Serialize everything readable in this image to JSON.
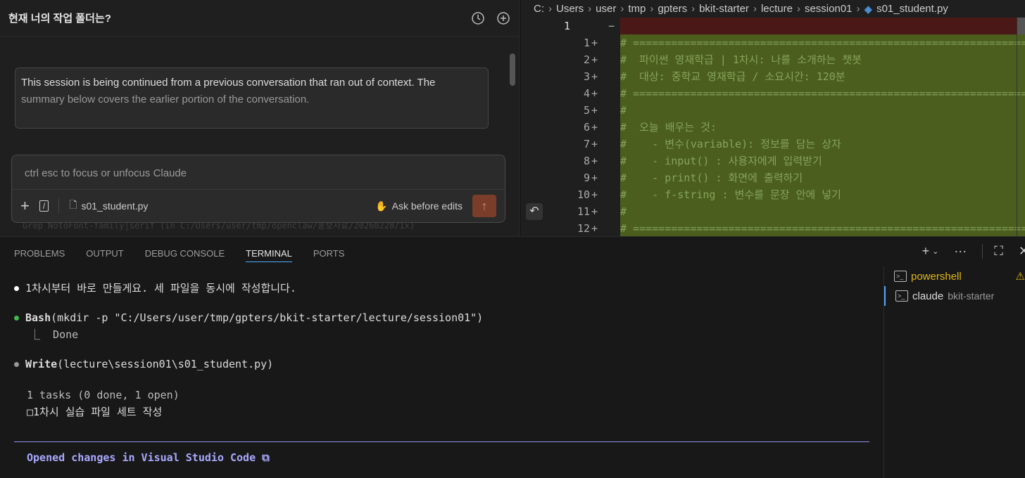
{
  "chat": {
    "title": "현재 너의 작업 폴더는?",
    "message_line1": "This session is being continued from a previous conversation that ran out of context. The",
    "message_line2": "summary below covers the earlier portion of the conversation.",
    "background_tool": "Grep  NotoFont-family|serif  (in C:/Users/user/tmp/openclaw/홍보자료/20260228/1x)",
    "input_placeholder": "ctrl esc to focus or unfocus Claude",
    "attached_file": "s01_student.py",
    "mode_label": "Ask before edits",
    "send_color": "#7a3d2a"
  },
  "editor": {
    "breadcrumb": [
      "C:",
      "Users",
      "user",
      "tmp",
      "gpters",
      "bkit-starter",
      "lecture",
      "session01",
      "s01_student.py"
    ],
    "deleted_line": {
      "num": "1",
      "marker": "−",
      "code": ""
    },
    "added_lines": [
      {
        "num": "1",
        "code": "# ========================================================================="
      },
      {
        "num": "2",
        "code": "#  파이썬 영재학급 | 1차시: 나를 소개하는 챗봇"
      },
      {
        "num": "3",
        "code": "#  대상: 중학교 영재학급 / 소요시간: 120분"
      },
      {
        "num": "4",
        "code": "# ========================================================================="
      },
      {
        "num": "5",
        "code": "#"
      },
      {
        "num": "6",
        "code": "#  오늘 배우는 것:"
      },
      {
        "num": "7",
        "code": "#    - 변수(variable): 정보를 담는 상자"
      },
      {
        "num": "8",
        "code": "#    - input() : 사용자에게 입력받기"
      },
      {
        "num": "9",
        "code": "#    - print() : 화면에 출력하기"
      },
      {
        "num": "10",
        "code": "#    - f-string : 변수를 문장 안에 넣기"
      },
      {
        "num": "11",
        "code": "#"
      },
      {
        "num": "12",
        "code": "# ========================================================================="
      }
    ],
    "added_marker": "+"
  },
  "panel": {
    "tabs": [
      "PROBLEMS",
      "OUTPUT",
      "DEBUG CONSOLE",
      "TERMINAL",
      "PORTS"
    ],
    "active_tab": "TERMINAL",
    "terminal": {
      "line1": "1차시부터 바로 만들게요. 세 파일을 동시에 작성합니다.",
      "bash_tool": "Bash",
      "bash_args": "(mkdir -p \"C:/Users/user/tmp/gpters/bkit-starter/lecture/session01\")",
      "bash_result": "⎿  Done",
      "write_tool": "Write",
      "write_args": "(lecture\\session01\\s01_student.py)",
      "tasks_summary": "1 tasks (0 done, 1 open)",
      "task_item": "□1차시 실습 파일 세트 작성",
      "opened": "Opened changes in Visual Studio Code ⧉"
    },
    "terminals": [
      {
        "name": "powershell",
        "color": "#e2b714"
      },
      {
        "name": "claude",
        "detail": "bkit-starter"
      }
    ]
  }
}
